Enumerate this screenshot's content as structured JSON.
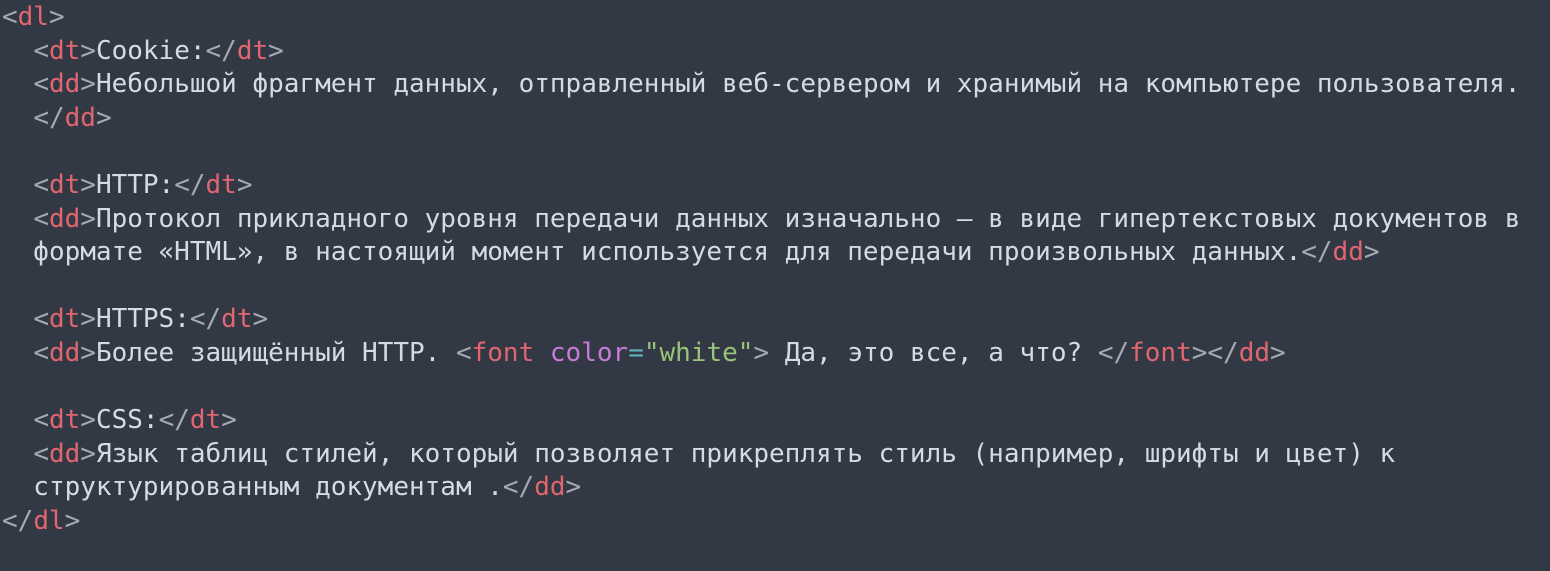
{
  "theme": {
    "background": "#323844",
    "text": "#d6dbe3",
    "bracket": "#a4aab4",
    "tag": "#e0666f",
    "attribute": "#c77bd6",
    "equals": "#5fb4be",
    "string": "#98c379"
  },
  "code_lines": [
    [
      {
        "k": "bracket",
        "t": "<"
      },
      {
        "k": "tag",
        "t": "dl"
      },
      {
        "k": "bracket",
        "t": ">"
      }
    ],
    [
      {
        "k": "text",
        "t": "  "
      },
      {
        "k": "bracket",
        "t": "<"
      },
      {
        "k": "tag",
        "t": "dt"
      },
      {
        "k": "bracket",
        "t": ">"
      },
      {
        "k": "text",
        "t": "Cookie:"
      },
      {
        "k": "bracket",
        "t": "</"
      },
      {
        "k": "tag",
        "t": "dt"
      },
      {
        "k": "bracket",
        "t": ">"
      }
    ],
    [
      {
        "k": "text",
        "t": "  "
      },
      {
        "k": "bracket",
        "t": "<"
      },
      {
        "k": "tag",
        "t": "dd"
      },
      {
        "k": "bracket",
        "t": ">"
      },
      {
        "k": "text",
        "t": "Небольшой фрагмент данных, отправленный веб-сервером и хранимый на компьютере пользователя."
      }
    ],
    [
      {
        "k": "text",
        "t": "  "
      },
      {
        "k": "bracket",
        "t": "</"
      },
      {
        "k": "tag",
        "t": "dd"
      },
      {
        "k": "bracket",
        "t": ">"
      }
    ],
    [],
    [
      {
        "k": "text",
        "t": "  "
      },
      {
        "k": "bracket",
        "t": "<"
      },
      {
        "k": "tag",
        "t": "dt"
      },
      {
        "k": "bracket",
        "t": ">"
      },
      {
        "k": "text",
        "t": "HTTP:"
      },
      {
        "k": "bracket",
        "t": "</"
      },
      {
        "k": "tag",
        "t": "dt"
      },
      {
        "k": "bracket",
        "t": ">"
      }
    ],
    [
      {
        "k": "text",
        "t": "  "
      },
      {
        "k": "bracket",
        "t": "<"
      },
      {
        "k": "tag",
        "t": "dd"
      },
      {
        "k": "bracket",
        "t": ">"
      },
      {
        "k": "text",
        "t": "Протокол прикладного уровня передачи данных изначально — в виде гипертекстовых документов в"
      }
    ],
    [
      {
        "k": "text",
        "t": "  формате «HTML», в настоящий момент используется для передачи произвольных данных."
      },
      {
        "k": "bracket",
        "t": "</"
      },
      {
        "k": "tag",
        "t": "dd"
      },
      {
        "k": "bracket",
        "t": ">"
      }
    ],
    [],
    [
      {
        "k": "text",
        "t": "  "
      },
      {
        "k": "bracket",
        "t": "<"
      },
      {
        "k": "tag",
        "t": "dt"
      },
      {
        "k": "bracket",
        "t": ">"
      },
      {
        "k": "text",
        "t": "HTTPS:"
      },
      {
        "k": "bracket",
        "t": "</"
      },
      {
        "k": "tag",
        "t": "dt"
      },
      {
        "k": "bracket",
        "t": ">"
      }
    ],
    [
      {
        "k": "text",
        "t": "  "
      },
      {
        "k": "bracket",
        "t": "<"
      },
      {
        "k": "tag",
        "t": "dd"
      },
      {
        "k": "bracket",
        "t": ">"
      },
      {
        "k": "text",
        "t": "Более защищённый HTTP. "
      },
      {
        "k": "bracket",
        "t": "<"
      },
      {
        "k": "tag",
        "t": "font"
      },
      {
        "k": "text",
        "t": " "
      },
      {
        "k": "attr",
        "t": "color"
      },
      {
        "k": "eq",
        "t": "="
      },
      {
        "k": "str",
        "t": "\"white\""
      },
      {
        "k": "bracket",
        "t": ">"
      },
      {
        "k": "text",
        "t": " Да, это все, а что? "
      },
      {
        "k": "bracket",
        "t": "</"
      },
      {
        "k": "tag",
        "t": "font"
      },
      {
        "k": "bracket",
        "t": "></"
      },
      {
        "k": "tag",
        "t": "dd"
      },
      {
        "k": "bracket",
        "t": ">"
      }
    ],
    [],
    [
      {
        "k": "text",
        "t": "  "
      },
      {
        "k": "bracket",
        "t": "<"
      },
      {
        "k": "tag",
        "t": "dt"
      },
      {
        "k": "bracket",
        "t": ">"
      },
      {
        "k": "text",
        "t": "CSS:"
      },
      {
        "k": "bracket",
        "t": "</"
      },
      {
        "k": "tag",
        "t": "dt"
      },
      {
        "k": "bracket",
        "t": ">"
      }
    ],
    [
      {
        "k": "text",
        "t": "  "
      },
      {
        "k": "bracket",
        "t": "<"
      },
      {
        "k": "tag",
        "t": "dd"
      },
      {
        "k": "bracket",
        "t": ">"
      },
      {
        "k": "text",
        "t": "Язык таблиц стилей, который позволяет прикреплять стиль (например, шрифты и цвет) к"
      }
    ],
    [
      {
        "k": "text",
        "t": "  структурированным документам ."
      },
      {
        "k": "bracket",
        "t": "</"
      },
      {
        "k": "tag",
        "t": "dd"
      },
      {
        "k": "bracket",
        "t": ">"
      }
    ],
    [
      {
        "k": "bracket",
        "t": "</"
      },
      {
        "k": "tag",
        "t": "dl"
      },
      {
        "k": "bracket",
        "t": ">"
      }
    ]
  ]
}
